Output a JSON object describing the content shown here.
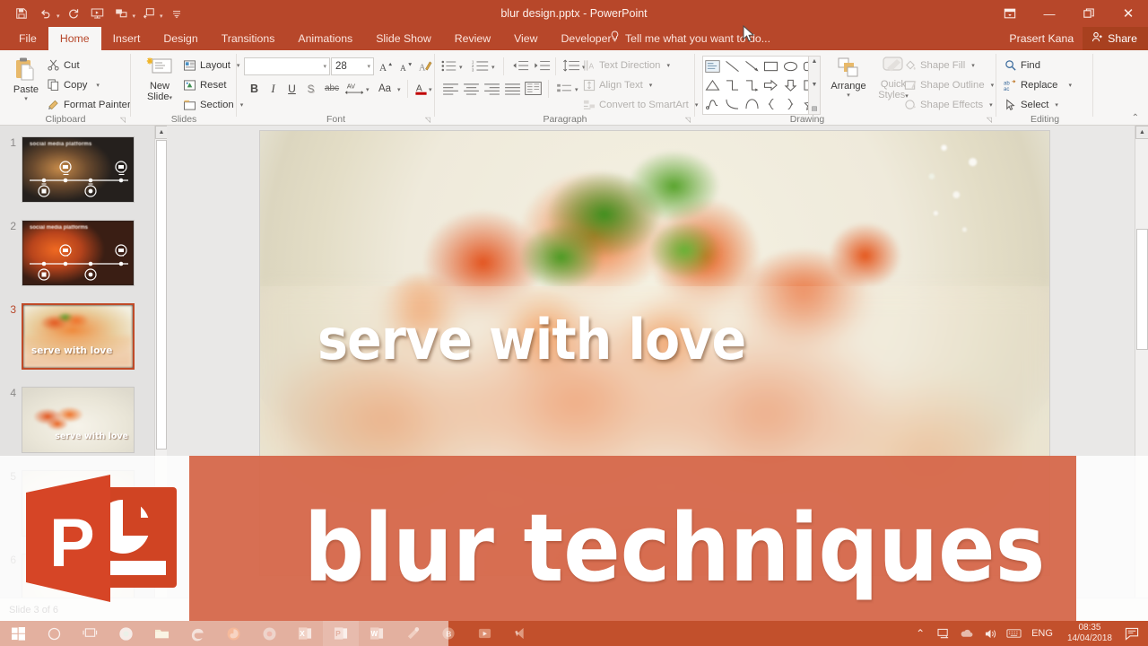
{
  "window": {
    "title": "blur design.pptx - PowerPoint",
    "quick_access": [
      {
        "name": "save-icon",
        "glyph": "὚B"
      },
      {
        "name": "undo-icon",
        "glyph": "↶"
      },
      {
        "name": "redo-icon",
        "glyph": "↻"
      },
      {
        "name": "start-from-beginning-icon",
        "glyph": "▶"
      },
      {
        "name": "presenter-view-icon",
        "glyph": "▣"
      },
      {
        "name": "touch-mode-icon",
        "glyph": "⇤"
      },
      {
        "name": "customize-quick-access-icon",
        "glyph": "▾"
      }
    ],
    "controls": {
      "ribbon_display_options": "⤴",
      "minimize": "—",
      "restore": "❐",
      "close": "✕"
    }
  },
  "ribbon": {
    "tabs": [
      {
        "label": "File",
        "active": false
      },
      {
        "label": "Home",
        "active": true
      },
      {
        "label": "Insert",
        "active": false
      },
      {
        "label": "Design",
        "active": false
      },
      {
        "label": "Transitions",
        "active": false
      },
      {
        "label": "Animations",
        "active": false
      },
      {
        "label": "Slide Show",
        "active": false
      },
      {
        "label": "Review",
        "active": false
      },
      {
        "label": "View",
        "active": false
      },
      {
        "label": "Developer",
        "active": false
      }
    ],
    "tell_me": "Tell me what you want to do...",
    "user_name": "Prasert Kana",
    "share_label": "Share",
    "groups": {
      "clipboard": {
        "label": "Clipboard",
        "paste": "Paste",
        "cut": "Cut",
        "copy": "Copy",
        "format_painter": "Format Painter"
      },
      "slides": {
        "label": "Slides",
        "new_slide_line1": "New",
        "new_slide_line2": "Slide",
        "layout": "Layout",
        "reset": "Reset",
        "section": "Section"
      },
      "font": {
        "label": "Font",
        "font_name": "",
        "font_name_placeholder": "",
        "font_size": "28",
        "grow_font": "A",
        "shrink_font": "A",
        "clear_formatting": "✐",
        "bold": "B",
        "italic": "I",
        "underline": "U",
        "shadow": "S",
        "strikethrough": "abc",
        "character_spacing": "AV",
        "change_case": "Aa",
        "font_color": "A"
      },
      "paragraph": {
        "label": "Paragraph",
        "text_direction": "Text Direction",
        "align_text": "Align Text",
        "convert_to_smartart": "Convert to SmartArt"
      },
      "drawing": {
        "label": "Drawing",
        "arrange": "Arrange",
        "quick_styles_line1": "Quick",
        "quick_styles_line2": "Styles",
        "shape_fill": "Shape Fill",
        "shape_outline": "Shape Outline",
        "shape_effects": "Shape Effects",
        "shapes_rows": [
          [
            "textbox",
            "line",
            "arrow",
            "rectangle",
            "oval",
            "rounded-rectangle"
          ],
          [
            "triangle",
            "elbow-connector",
            "elbow-arrow-connector",
            "right-arrow",
            "down-arrow",
            "pentagon-tag"
          ],
          [
            "scribble",
            "curve",
            "arc",
            "left-brace",
            "right-brace",
            "star"
          ]
        ]
      },
      "editing": {
        "label": "Editing",
        "find": "Find",
        "replace": "Replace",
        "select": "Select"
      }
    },
    "collapse_ribbon_icon": "⌃"
  },
  "thumbnails": {
    "slides": [
      {
        "number": "1",
        "title": "social media platforms",
        "selected": false,
        "theme": "dark"
      },
      {
        "number": "2",
        "title": "social media platforms",
        "selected": false,
        "theme": "orange"
      },
      {
        "number": "3",
        "title": "serve with love",
        "selected": true,
        "theme": "food"
      },
      {
        "number": "4",
        "title": "serve with love",
        "selected": false,
        "theme": "food-light"
      },
      {
        "number": "5",
        "title": "",
        "selected": false,
        "theme": "food-pale"
      },
      {
        "number": "6",
        "title": "",
        "selected": false,
        "theme": "food-pale"
      }
    ]
  },
  "slide": {
    "title": "serve with love"
  },
  "status_bar": {
    "text": "Slide 3 of 6"
  },
  "banner": {
    "text": "blur techniques"
  },
  "overlay": {
    "logo_letter": "P"
  },
  "taskbar": {
    "items": [
      {
        "name": "start-button",
        "glyph": "⊞"
      },
      {
        "name": "cortana-search-icon",
        "glyph": "○"
      },
      {
        "name": "task-view-icon",
        "glyph": "▭"
      },
      {
        "name": "chrome-icon",
        "glyph": "●"
      },
      {
        "name": "file-explorer-icon",
        "glyph": "▤"
      },
      {
        "name": "edge-icon",
        "glyph": "e"
      },
      {
        "name": "firefox-icon",
        "glyph": "◉"
      },
      {
        "name": "chrome-taskbar-icon",
        "glyph": "◎"
      },
      {
        "name": "excel-icon",
        "glyph": "X"
      },
      {
        "name": "powerpoint-icon",
        "glyph": "P"
      },
      {
        "name": "word-icon",
        "glyph": "W"
      },
      {
        "name": "snagit-icon",
        "glyph": "⚒"
      },
      {
        "name": "bandicam-icon",
        "glyph": "B"
      },
      {
        "name": "camtasia-icon",
        "glyph": "✂"
      },
      {
        "name": "visual-studio-code-icon",
        "glyph": "◁"
      }
    ],
    "tray": {
      "show_hidden_icons": "⌃",
      "network_icon": "⎙",
      "onedrive_icon": "☁",
      "volume_icon": "◂))",
      "keyboard_icon": "⌨",
      "language": "ENG",
      "time": "08:35",
      "date": "14/04/2018",
      "action_center_icon": "὜9"
    }
  },
  "colors": {
    "ribbon_accent": "#b7472a",
    "ribbon_bg": "#f7f6f5",
    "selection": "#c04a27",
    "banner": "#cd4b28",
    "taskbar": "#c2502c"
  }
}
